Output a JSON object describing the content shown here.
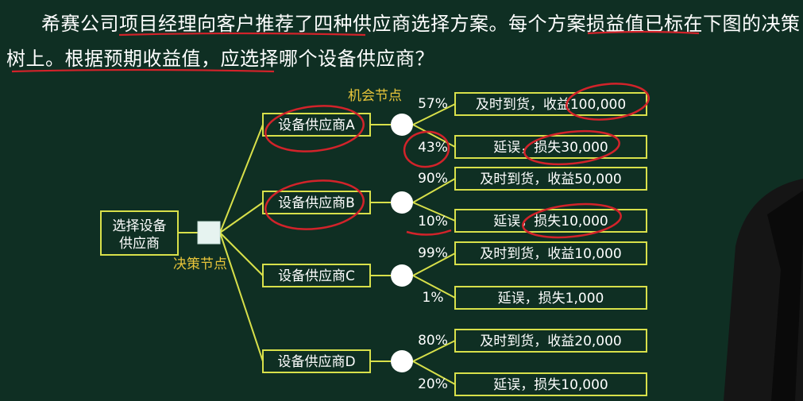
{
  "question": "希赛公司项目经理向客户推荐了四种供应商选择方案。每个方案损益值已标在下图的决策树上。根据预期收益值，应选择哪个设备供应商？",
  "root": {
    "label": "选择设备\n供应商"
  },
  "decision_node_label": "决策节点",
  "chance_node_label": "机会节点",
  "suppliers": [
    {
      "label": "设备供应商A",
      "outcomes": [
        {
          "prob": "57%",
          "label": "及时到货，收益100,000"
        },
        {
          "prob": "43%",
          "label": "延误，损失30,000"
        }
      ]
    },
    {
      "label": "设备供应商B",
      "outcomes": [
        {
          "prob": "90%",
          "label": "及时到货，收益50,000"
        },
        {
          "prob": "10%",
          "label": "延误，损失10,000"
        }
      ]
    },
    {
      "label": "设备供应商C",
      "outcomes": [
        {
          "prob": "99%",
          "label": "及时到货，收益10,000"
        },
        {
          "prob": "1%",
          "label": "延误，损失1,000"
        }
      ]
    },
    {
      "label": "设备供应商D",
      "outcomes": [
        {
          "prob": "80%",
          "label": "及时到货，收益20,000"
        },
        {
          "prob": "20%",
          "label": "延误，损失10,000"
        }
      ]
    }
  ],
  "colors": {
    "background": "#0f2f23",
    "line": "#d8e04a",
    "annotation": "#d2232a",
    "node_label": "#e8c53a"
  }
}
